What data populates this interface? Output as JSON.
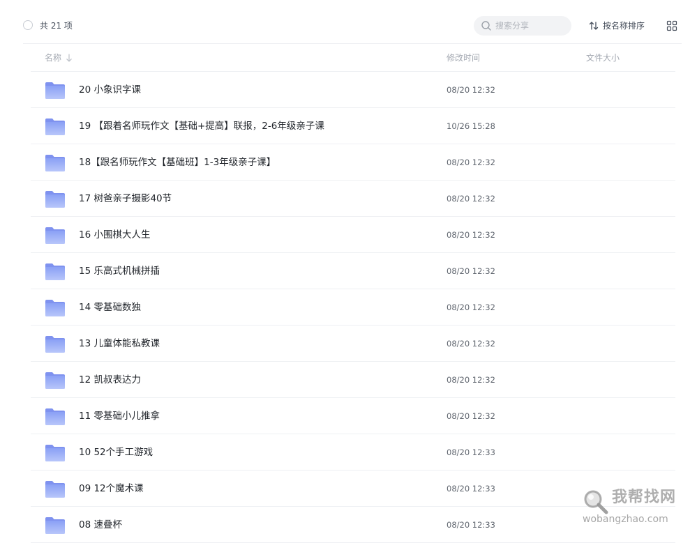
{
  "toolbar": {
    "total_label": "共 21 项",
    "search_placeholder": "搜索分享",
    "sort_label": "按名称排序"
  },
  "table": {
    "headers": {
      "name": "名称",
      "modified": "修改时间",
      "size": "文件大小"
    },
    "rows": [
      {
        "name": "20 小象识字课",
        "modified": "08/20 12:32",
        "size": ""
      },
      {
        "name": "19 【跟着名师玩作文【基础+提高】联报，2-6年级亲子课",
        "modified": "10/26 15:28",
        "size": ""
      },
      {
        "name": "18【跟名师玩作文【基础班】1-3年级亲子课】",
        "modified": "08/20 12:32",
        "size": ""
      },
      {
        "name": "17 树爸亲子摄影40节",
        "modified": "08/20 12:32",
        "size": ""
      },
      {
        "name": "16 小围棋大人生",
        "modified": "08/20 12:32",
        "size": ""
      },
      {
        "name": "15 乐高式机械拼插",
        "modified": "08/20 12:32",
        "size": ""
      },
      {
        "name": "14 零基础数独",
        "modified": "08/20 12:32",
        "size": ""
      },
      {
        "name": "13 儿童体能私教课",
        "modified": "08/20 12:32",
        "size": ""
      },
      {
        "name": "12 凯叔表达力",
        "modified": "08/20 12:32",
        "size": ""
      },
      {
        "name": "11 零基础小儿推拿",
        "modified": "08/20 12:32",
        "size": ""
      },
      {
        "name": "10 52个手工游戏",
        "modified": "08/20 12:33",
        "size": ""
      },
      {
        "name": "09 12个魔术课",
        "modified": "08/20 12:33",
        "size": ""
      },
      {
        "name": "08 速叠杯",
        "modified": "08/20 12:33",
        "size": ""
      }
    ]
  },
  "watermark": {
    "title": "我帮找网",
    "url": "wobangzhao.com"
  },
  "colors": {
    "folder_top": "#8aa0f5",
    "folder_bottom": "#b8c6fa",
    "divider": "#eef0f3",
    "muted_text": "#a4a9b2"
  }
}
